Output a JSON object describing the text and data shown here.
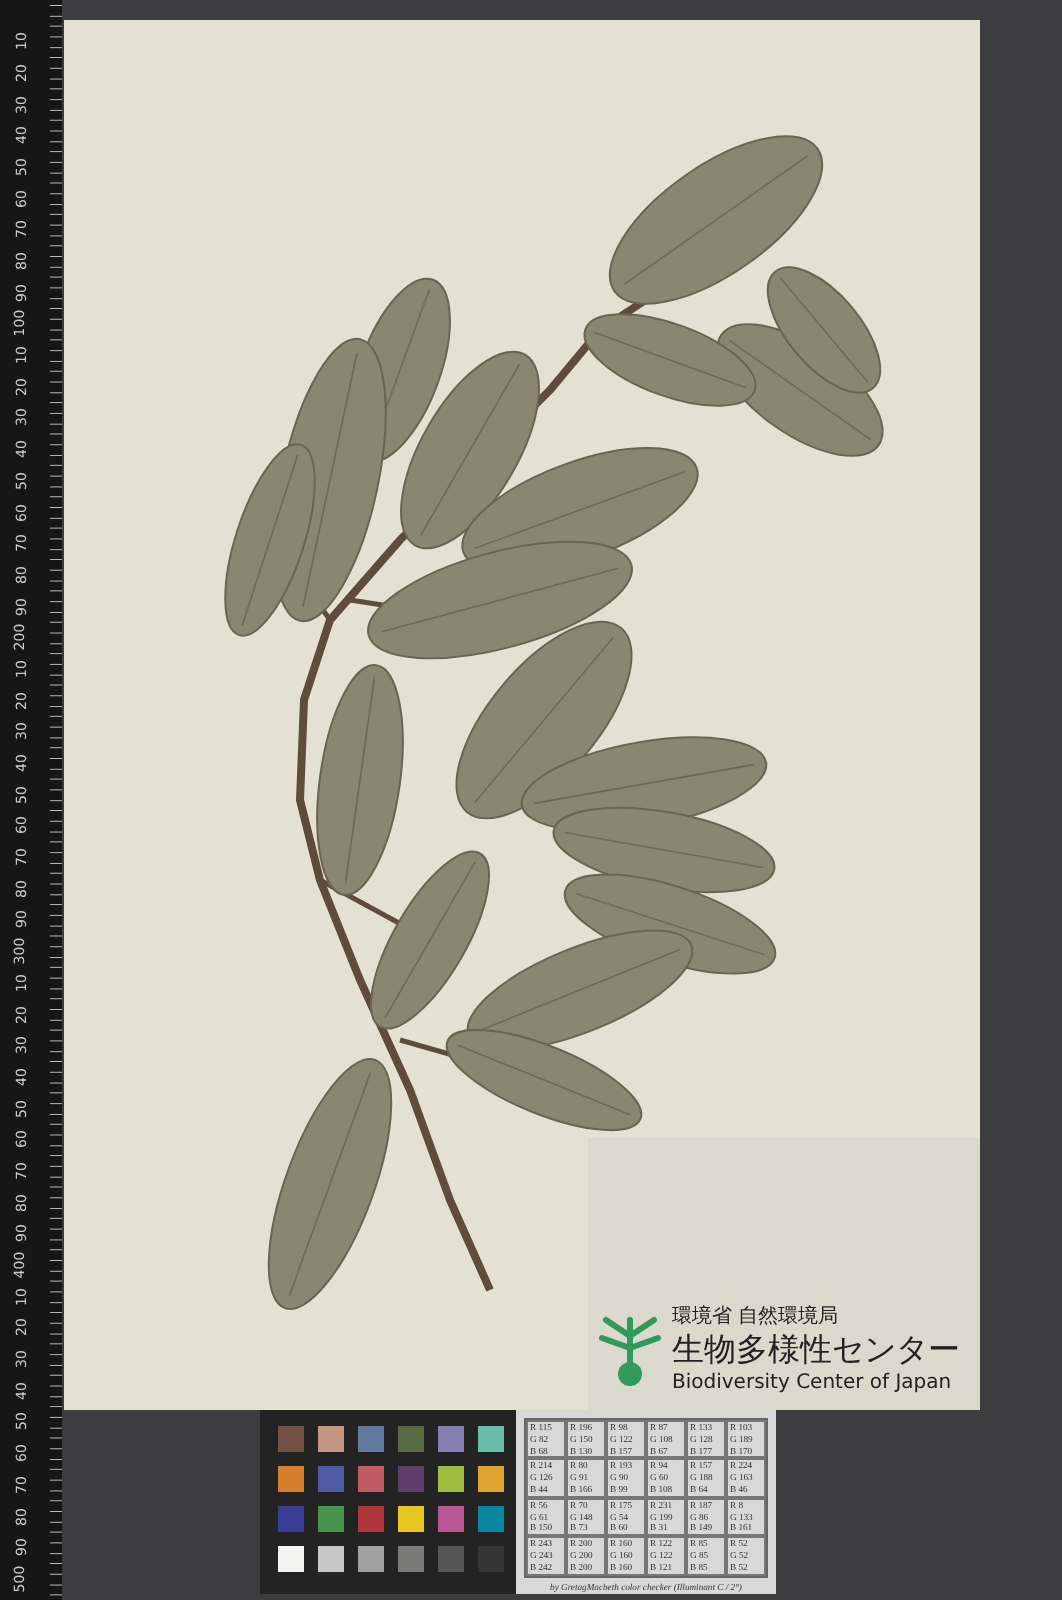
{
  "ruler": {
    "marks": [
      "10",
      "20",
      "30",
      "40",
      "50",
      "60",
      "70",
      "80",
      "90",
      "100",
      "10",
      "20",
      "30",
      "40",
      "50",
      "60",
      "70",
      "80",
      "90",
      "200",
      "10",
      "20",
      "30",
      "40",
      "50",
      "60",
      "70",
      "80",
      "90",
      "300",
      "10",
      "20",
      "30",
      "40",
      "50",
      "60",
      "70",
      "80",
      "90",
      "400",
      "10",
      "20",
      "30",
      "40",
      "50",
      "60",
      "70",
      "80",
      "90",
      "500"
    ]
  },
  "label": {
    "agency": "環境省 自然環境局",
    "name_ja": "生物多様性センター",
    "name_en": "Biodiversity Center of Japan"
  },
  "color_checker": {
    "swatches": [
      {
        "color": "#735244"
      },
      {
        "color": "#c49682"
      },
      {
        "color": "#627a9d"
      },
      {
        "color": "#576c43"
      },
      {
        "color": "#8580b1"
      },
      {
        "color": "#67bdaa"
      },
      {
        "color": "#d67e2c"
      },
      {
        "color": "#505ba6"
      },
      {
        "color": "#c15a63"
      },
      {
        "color": "#5e3c6c"
      },
      {
        "color": "#9dbc40"
      },
      {
        "color": "#e0a32e"
      },
      {
        "color": "#383d96"
      },
      {
        "color": "#469449"
      },
      {
        "color": "#af363c"
      },
      {
        "color": "#e7c71f"
      },
      {
        "color": "#bb5695"
      },
      {
        "color": "#0885a1"
      },
      {
        "color": "#f3f3f2"
      },
      {
        "color": "#c8c8c8"
      },
      {
        "color": "#a0a0a0"
      },
      {
        "color": "#7a7a79"
      },
      {
        "color": "#555555"
      },
      {
        "color": "#343434"
      }
    ],
    "table": [
      [
        "R 115",
        "G 82",
        "B 68"
      ],
      [
        "R 196",
        "G 150",
        "B 130"
      ],
      [
        "R 98",
        "G 122",
        "B 157"
      ],
      [
        "R 87",
        "G 108",
        "B 67"
      ],
      [
        "R 133",
        "G 128",
        "B 177"
      ],
      [
        "R 103",
        "G 189",
        "B 170"
      ],
      [
        "R 214",
        "G 126",
        "B 44"
      ],
      [
        "R 80",
        "G 91",
        "B 166"
      ],
      [
        "R 193",
        "G 90",
        "B 99"
      ],
      [
        "R 94",
        "G 60",
        "B 108"
      ],
      [
        "R 157",
        "G 188",
        "B 64"
      ],
      [
        "R 224",
        "G 163",
        "B 46"
      ],
      [
        "R 56",
        "G 61",
        "B 150"
      ],
      [
        "R 70",
        "G 148",
        "B 73"
      ],
      [
        "R 175",
        "G 54",
        "B 60"
      ],
      [
        "R 231",
        "G 199",
        "B 31"
      ],
      [
        "R 187",
        "G 86",
        "B 149"
      ],
      [
        "R 8",
        "G 133",
        "B 161"
      ],
      [
        "R 243",
        "G 243",
        "B 242"
      ],
      [
        "R 200",
        "G 200",
        "B 200"
      ],
      [
        "R 160",
        "G 160",
        "B 160"
      ],
      [
        "R 122",
        "G 122",
        "B 121"
      ],
      [
        "R 85",
        "G 85",
        "B 85"
      ],
      [
        "R 52",
        "G 52",
        "B 52"
      ]
    ],
    "caption": "by GretagMacbeth color checker (Illuminant C / 2°)"
  }
}
